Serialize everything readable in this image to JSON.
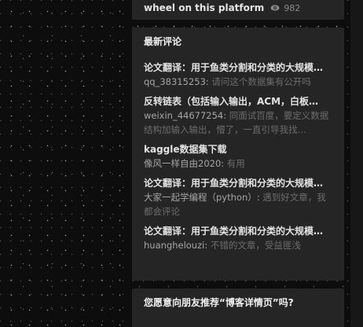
{
  "top_article": {
    "title": "wheel on this platform",
    "views": "982",
    "icon": "eye-icon"
  },
  "latest_comments": {
    "heading": "最新评论",
    "items": [
      {
        "title": "论文翻译：用于鱼类分割和分类的大规模…",
        "user": "qq_38315253:",
        "text": "请问这个数据集有公开吗"
      },
      {
        "title": "反转链表（包括输入输出，ACM，白板…",
        "user": "weixin_44677254:",
        "text": "同面试百度，要定义数据结构加输入输出，懵了，一直引导我找…"
      },
      {
        "title": "kaggle数据集下载",
        "user": "像风一样自由2020:",
        "text": "有用"
      },
      {
        "title": "论文翻译：用于鱼类分割和分类的大规模…",
        "user": "大家一起学编程（python）:",
        "text": "遇到好文章，我都会评论"
      },
      {
        "title": "论文翻译：用于鱼类分割和分类的大规模…",
        "user": "huanghelouzi:",
        "text": "不错的文章，受益匪浅"
      }
    ]
  },
  "recommend": {
    "heading": "您愿意向朋友推荐“博客详情页”吗?"
  },
  "colors": {
    "background": "#0d0d0e",
    "card": "#252526",
    "title_text": "#e3e3e3",
    "muted_text": "#6c6c6c",
    "user_text": "#a6a6a6"
  }
}
